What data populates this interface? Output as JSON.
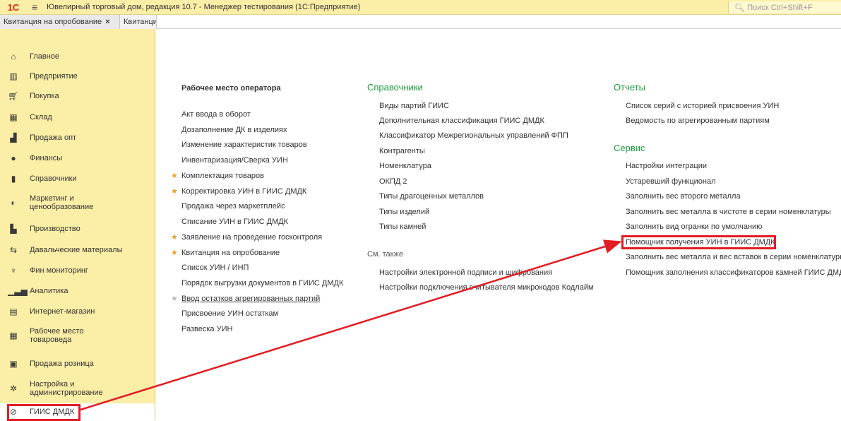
{
  "window": {
    "logo_text": "1С",
    "title": "Ювелирный торговый дом, редакция 10.7 - Менеджер тестирования (1С:Предприятие)",
    "search_placeholder": "Поиск Ctrl+Shift+F"
  },
  "tabs": [
    {
      "label": "Квитанция на опробование",
      "close": "×"
    },
    {
      "label": "Квитанци"
    }
  ],
  "sidebar": {
    "items": [
      {
        "label": "Главное",
        "icon": "home-icon"
      },
      {
        "label": "Предприятие",
        "icon": "building-icon"
      },
      {
        "label": "Покупка",
        "icon": "cart-icon"
      },
      {
        "label": "Склад",
        "icon": "warehouse-icon"
      },
      {
        "label": "Продажа опт",
        "icon": "bag-icon"
      },
      {
        "label": "Финансы",
        "icon": "finance-icon"
      },
      {
        "label": "Справочники",
        "icon": "book-icon"
      },
      {
        "label": "Маркетинг и",
        "label2": "ценообразование",
        "icon": "marketing-icon"
      },
      {
        "label": "Производство",
        "icon": "factory-icon"
      },
      {
        "label": "Давальческие материалы",
        "icon": "materials-icon"
      },
      {
        "label": "Фин мониторинг",
        "icon": "monitoring-icon"
      },
      {
        "label": "Аналитика",
        "icon": "chart-icon"
      },
      {
        "label": "Интернет-магазин",
        "icon": "shop-icon"
      },
      {
        "label": "Рабочее место",
        "label2": "товароведа",
        "icon": "workplace-icon"
      },
      {
        "label": "Продажа розница",
        "icon": "register-icon"
      },
      {
        "label": "Настройка и",
        "label2": "администрирование",
        "icon": "gear-icon"
      },
      {
        "label": "ГИИС ДМДК",
        "icon": "gis-icon"
      }
    ]
  },
  "col1": {
    "heading": "Рабочее место оператора",
    "items": [
      {
        "label": "Акт ввода в оборот"
      },
      {
        "label": "Дозаполнение ДК в изделиях"
      },
      {
        "label": "Изменение характеристик товаров"
      },
      {
        "label": "Инвентаризация/Сверка УИН"
      },
      {
        "label": "Комплектация товаров",
        "star": "★"
      },
      {
        "label": "Корректировка УИН в ГИИС ДМДК",
        "star": "★"
      },
      {
        "label": "Продажа через маркетплейс"
      },
      {
        "label": "Списание УИН в ГИИС ДМДК"
      },
      {
        "label": "Заявление на проведение госконтроля",
        "star": "★"
      },
      {
        "label": "Квитанция на опробование",
        "star": "★"
      },
      {
        "label": "Список УИН / ИНП"
      },
      {
        "label": "Порядок выгрузки документов в ГИИС ДМДК"
      },
      {
        "label": "Ввод остатков агрегированных партий",
        "star": "★"
      },
      {
        "label": "Присвоение УИН остаткам"
      },
      {
        "label": "Развеска УИН"
      }
    ]
  },
  "col2": {
    "heading": "Справочники",
    "items": [
      {
        "label": "Виды партий ГИИС"
      },
      {
        "label": "Дополнительная классификация ГИИС ДМДК"
      },
      {
        "label": "Классификатор Межрегиональных управлений ФПП"
      },
      {
        "label": "Контрагенты"
      },
      {
        "label": "Номенклатура"
      },
      {
        "label": "ОКПД 2"
      },
      {
        "label": "Типы драгоценных металлов"
      },
      {
        "label": "Типы изделий"
      },
      {
        "label": "Типы камней"
      }
    ],
    "see_also_heading": "См. также",
    "see_also": [
      {
        "label": "Настройки электронной подписи и шифрования"
      },
      {
        "label": "Настройки подключения считывателя микрокодов Кодлайм"
      }
    ]
  },
  "col3": {
    "reports_heading": "Отчеты",
    "reports": [
      {
        "label": "Список серий с историей присвоения УИН"
      },
      {
        "label": "Ведомость по агрегированным партиям"
      }
    ],
    "service_heading": "Сервис",
    "service": [
      {
        "label": "Настройки интеграции"
      },
      {
        "label": "Устаревший функционал"
      },
      {
        "label": "Заполнить вес второго металла"
      },
      {
        "label": "Заполнить вес металла в чистоте в серии номенклатуры"
      },
      {
        "label": "Заполнить вид огранки по умолчанию"
      },
      {
        "label": "Помощник получения УИН в ГИИС ДМДК"
      },
      {
        "label": "Заполнить вес металла и вес вставок в серии номенклатуры"
      },
      {
        "label": "Помощник заполнения классификаторов камней ГИИС ДМДК"
      }
    ]
  },
  "annotation": {
    "color": "#e31b23"
  }
}
